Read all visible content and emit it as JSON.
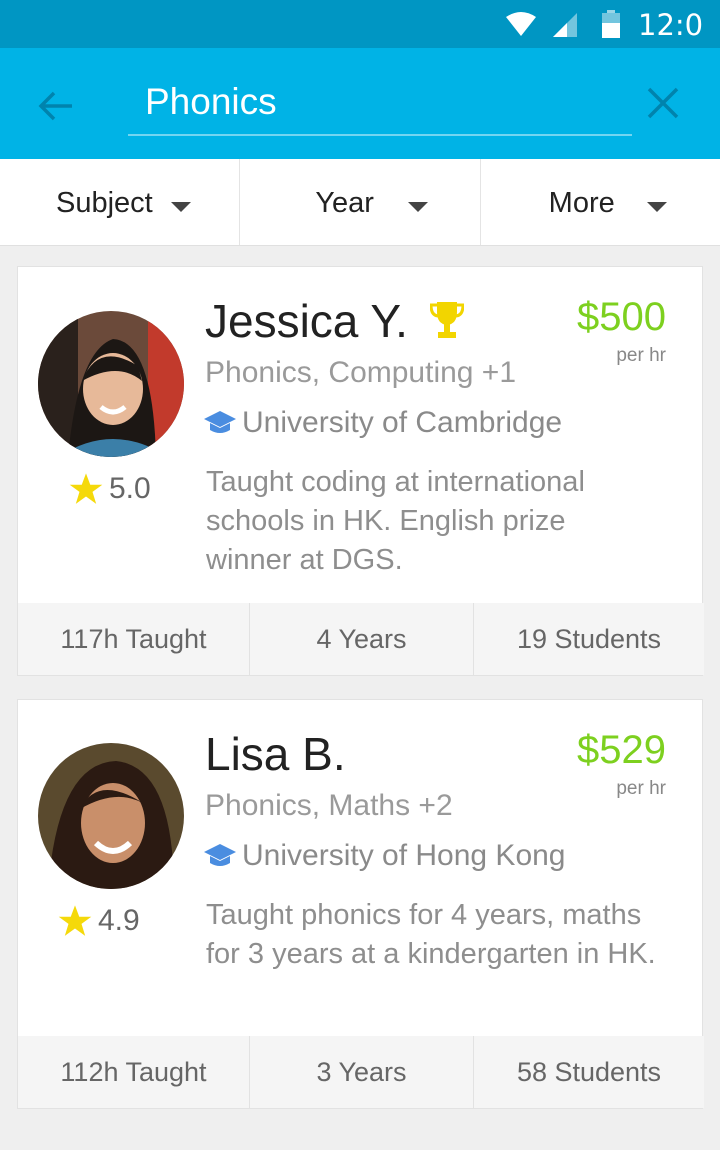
{
  "status_bar": {
    "time": "12:0"
  },
  "search": {
    "value": "Phonics"
  },
  "filters": [
    {
      "label": "Subject"
    },
    {
      "label": "Year"
    },
    {
      "label": "More"
    }
  ],
  "colors": {
    "status_bar": "#0096c3",
    "header": "#00b3e6",
    "price": "#7dd01f",
    "star": "#f5d90a",
    "cap": "#4a8de0"
  },
  "tutors": [
    {
      "name": "Jessica Y.",
      "badge_icon": "trophy-icon",
      "price": "$500",
      "price_unit": "per hr",
      "subjects": "Phonics, Computing +1",
      "university": "University of Cambridge",
      "rating": "5.0",
      "description": "Taught coding at international schools in HK. English prize winner at DGS.",
      "stats": {
        "taught": "117h Taught",
        "years": "4 Years",
        "students": "19 Students"
      }
    },
    {
      "name": "Lisa B.",
      "price": "$529",
      "price_unit": "per hr",
      "subjects": "Phonics, Maths +2",
      "university": "University of Hong Kong",
      "rating": "4.9",
      "description": "Taught phonics for 4 years, maths for 3 years at a kindergarten in HK.",
      "stats": {
        "taught": "112h Taught",
        "years": "3 Years",
        "students": "58 Students"
      }
    }
  ]
}
